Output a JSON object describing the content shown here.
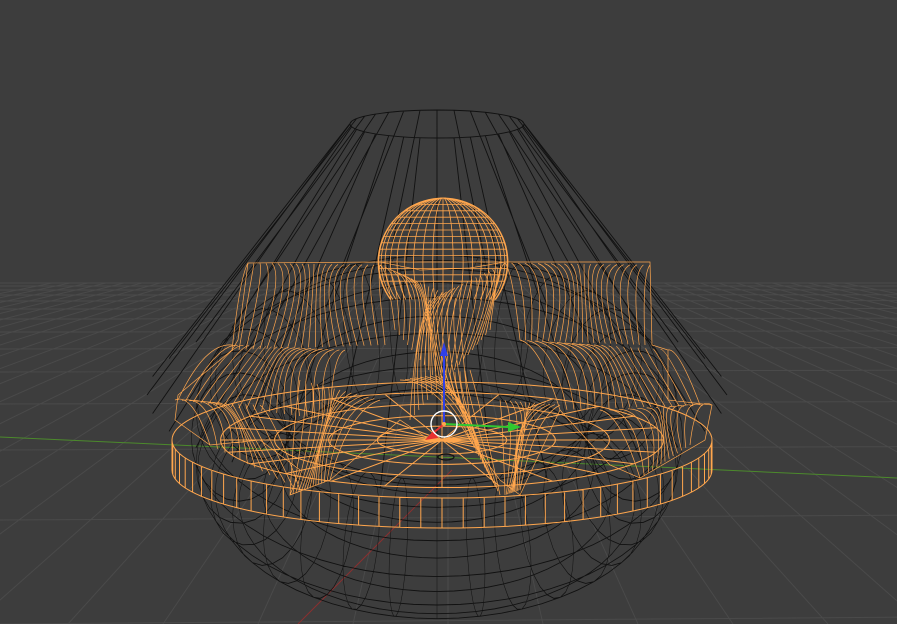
{
  "viewport": {
    "view_mode": "wireframe",
    "background_color": "#3d3d3d",
    "selection_color": "#ffa64d",
    "object_wire_color": "#111111",
    "grid_color": "#4a4a4a",
    "x_axis_color": "#8a3030",
    "y_axis_color": "#4c8a2c",
    "gizmo": {
      "x_color": "#e83030",
      "y_color": "#30c830",
      "z_color": "#3040e8",
      "pivot_ring_color": "#ffffff"
    }
  },
  "scene_objects": [
    {
      "name_icon": "cone-icon",
      "kind": "cone-wireframe",
      "selected": false
    },
    {
      "name_icon": "torus-icon",
      "kind": "torus-wireframe",
      "selected": false
    },
    {
      "name_icon": "mesh-icon",
      "kind": "ornament-wireframe",
      "selected": true
    },
    {
      "name_icon": "sphere-icon",
      "kind": "dome-sphere",
      "selected": true
    },
    {
      "name_icon": "cylinder-icon",
      "kind": "base-disc",
      "selected": true
    }
  ]
}
